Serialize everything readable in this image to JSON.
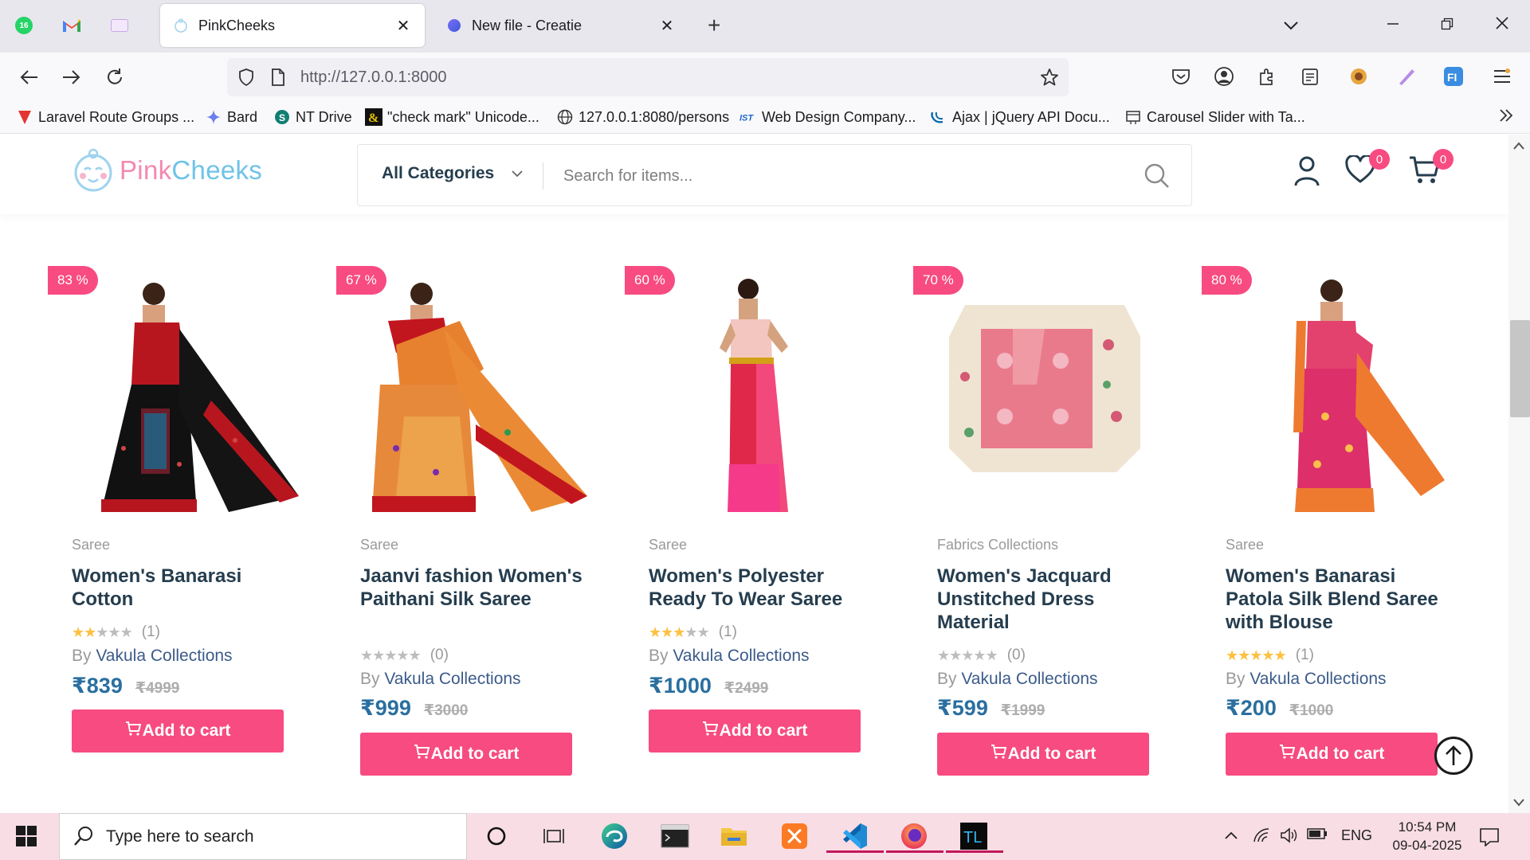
{
  "browser": {
    "pinned_tabs": [
      {
        "name": "whatsapp",
        "badge": "16"
      },
      {
        "name": "gmail"
      },
      {
        "name": "yahoo"
      }
    ],
    "tabs": [
      {
        "title": "PinkCheeks",
        "active": true
      },
      {
        "title": "New file - Creatie",
        "active": false
      }
    ],
    "url": "http://127.0.0.1:8000",
    "bookmarks": [
      {
        "label": "Laravel Route Groups ...",
        "icon": "laravel-icon"
      },
      {
        "label": "Bard",
        "icon": "bard-icon"
      },
      {
        "label": "NT Drive",
        "icon": "drive-icon"
      },
      {
        "label": "\"check mark\" Unicode...",
        "icon": "ampersand-icon"
      },
      {
        "label": "127.0.0.1:8080/persons",
        "icon": "globe-icon"
      },
      {
        "label": "Web Design Company...",
        "icon": "ist-icon"
      },
      {
        "label": "Ajax | jQuery API Docu...",
        "icon": "jquery-icon"
      },
      {
        "label": "Carousel Slider with Ta...",
        "icon": "carousel-icon"
      }
    ]
  },
  "site": {
    "logo_part1": "Pink",
    "logo_part2": "Cheeks",
    "category_select": "All Categories",
    "search_placeholder": "Search for items...",
    "wishlist_count": "0",
    "cart_count": "0"
  },
  "products": [
    {
      "discount": "83 %",
      "category": "Saree",
      "name": "Women's Banarasi Cotton",
      "rating": 2,
      "reviews": "(1)",
      "by": "By",
      "vendor": "Vakula Collections",
      "price": "₹839",
      "old_price": "₹4999",
      "button": "Add to cart",
      "image": "black-red-saree"
    },
    {
      "discount": "67 %",
      "category": "Saree",
      "name": "Jaanvi fashion Women's Paithani Silk Saree",
      "rating": 0,
      "reviews": "(0)",
      "by": "By",
      "vendor": "Vakula Collections",
      "price": "₹999",
      "old_price": "₹3000",
      "button": "Add to cart",
      "image": "orange-paithani-saree"
    },
    {
      "discount": "60 %",
      "category": "Saree",
      "name": "Women's Polyester Ready To Wear Saree",
      "rating": 3,
      "reviews": "(1)",
      "by": "By",
      "vendor": "Vakula Collections",
      "price": "₹1000",
      "old_price": "₹2499",
      "button": "Add to cart",
      "image": "pink-red-saree"
    },
    {
      "discount": "70 %",
      "category": "Fabrics Collections",
      "name": "Women's Jacquard Unstitched Dress Material",
      "rating": 0,
      "reviews": "(0)",
      "by": "By",
      "vendor": "Vakula Collections",
      "price": "₹599",
      "old_price": "₹1999",
      "button": "Add to cart",
      "image": "pink-dress-material"
    },
    {
      "discount": "80 %",
      "category": "Saree",
      "name": "Women's Banarasi Patola Silk Blend Saree with Blouse",
      "rating": 5,
      "reviews": "(1)",
      "by": "By",
      "vendor": "Vakula Collections",
      "price": "₹200",
      "old_price": "₹1000",
      "button": "Add to cart",
      "image": "pink-orange-patola-saree"
    }
  ],
  "taskbar": {
    "search_placeholder": "Type here to search",
    "language": "ENG",
    "time": "10:54 PM",
    "date": "09-04-2025"
  },
  "colors": {
    "accent": "#f74b81",
    "heading": "#253d4e",
    "price": "#2a6fa0",
    "star": "#fdc040"
  }
}
